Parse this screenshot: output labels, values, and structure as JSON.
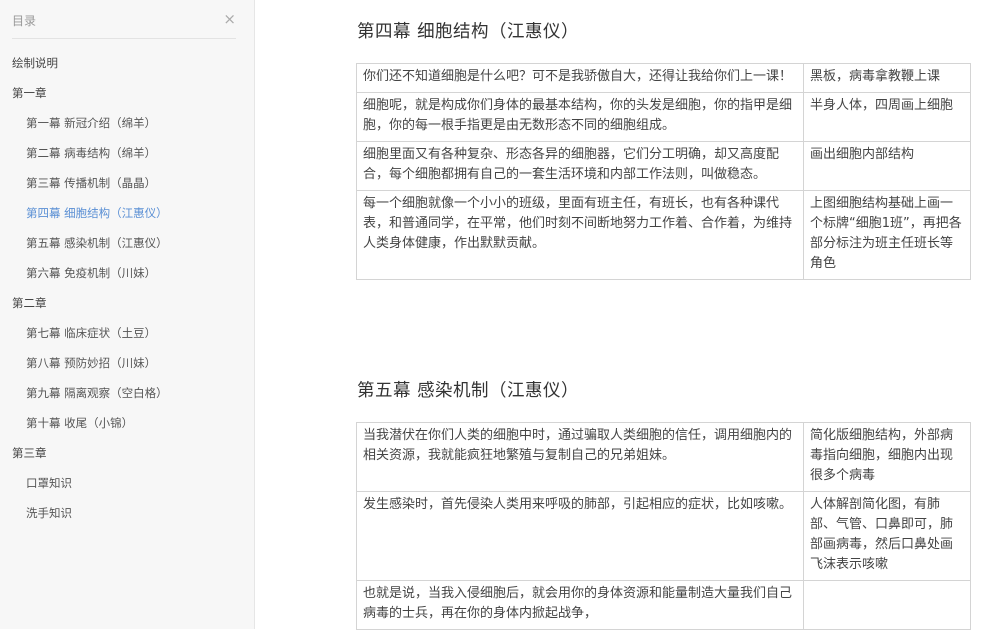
{
  "sidebar": {
    "title": "目录",
    "close_icon": "×",
    "items": [
      {
        "label": "绘制说明",
        "level": 1,
        "active": false
      },
      {
        "label": "第一章",
        "level": 1,
        "active": false
      },
      {
        "label": "第一幕  新冠介绍（绵羊）",
        "level": 2,
        "active": false
      },
      {
        "label": "第二幕  病毒结构（绵羊）",
        "level": 2,
        "active": false
      },
      {
        "label": "第三幕  传播机制（晶晶）",
        "level": 2,
        "active": false
      },
      {
        "label": "第四幕  细胞结构（江惠仪）",
        "level": 2,
        "active": true
      },
      {
        "label": "第五幕  感染机制（江惠仪）",
        "level": 2,
        "active": false
      },
      {
        "label": "第六幕  免疫机制（川妹）",
        "level": 2,
        "active": false
      },
      {
        "label": "第二章",
        "level": 1,
        "active": false
      },
      {
        "label": "第七幕  临床症状（土豆）",
        "level": 2,
        "active": false
      },
      {
        "label": "第八幕  预防妙招（川妹）",
        "level": 2,
        "active": false
      },
      {
        "label": "第九幕  隔离观察（空白格）",
        "level": 2,
        "active": false
      },
      {
        "label": "第十幕  收尾（小锦）",
        "level": 2,
        "active": false
      },
      {
        "label": "第三章",
        "level": 1,
        "active": false
      },
      {
        "label": "口罩知识",
        "level": 2,
        "active": false
      },
      {
        "label": "洗手知识",
        "level": 2,
        "active": false
      }
    ]
  },
  "sections": [
    {
      "title": "第四幕  细胞结构（江惠仪）",
      "rows": [
        {
          "text": "你们还不知道细胞是什么吧？可不是我骄傲自大，还得让我给你们上一课！",
          "note": "黑板，病毒拿教鞭上课"
        },
        {
          "text": "细胞呢，就是构成你们身体的最基本结构，你的头发是细胞，你的指甲是细胞，你的每一根手指更是由无数形态不同的细胞组成。",
          "note": "半身人体，四周画上细胞"
        },
        {
          "text": "细胞里面又有各种复杂、形态各异的细胞器，它们分工明确，却又高度配合，每个细胞都拥有自己的一套生活环境和内部工作法则，叫做稳态。",
          "note": "画出细胞内部结构"
        },
        {
          "text": "每一个细胞就像一个小小的班级，里面有班主任，有班长，也有各种课代表，和普通同学，在平常，他们时刻不间断地努力工作着、合作着，为维持人类身体健康，作出默默贡献。",
          "note": "上图细胞结构基础上画一个标牌“细胞1班”，再把各部分标注为班主任班长等角色"
        }
      ]
    },
    {
      "title": "第五幕  感染机制（江惠仪）",
      "rows": [
        {
          "text": "当我潜伏在你们人类的细胞中时，通过骗取人类细胞的信任，调用细胞内的相关资源，我就能疯狂地繁殖与复制自己的兄弟姐妹。",
          "note": "简化版细胞结构，外部病毒指向细胞，细胞内出现很多个病毒"
        },
        {
          "text": "发生感染时，首先侵染人类用来呼吸的肺部，引起相应的症状，比如咳嗽。",
          "note": "人体解剖简化图，有肺部、气管、口鼻即可，肺部画病毒，然后口鼻处画飞沫表示咳嗽"
        },
        {
          "text": "也就是说，当我入侵细胞后，就会用你的身体资源和能量制造大量我们自己病毒的士兵，再在你的身体内掀起战争，",
          "note": ""
        }
      ]
    }
  ]
}
